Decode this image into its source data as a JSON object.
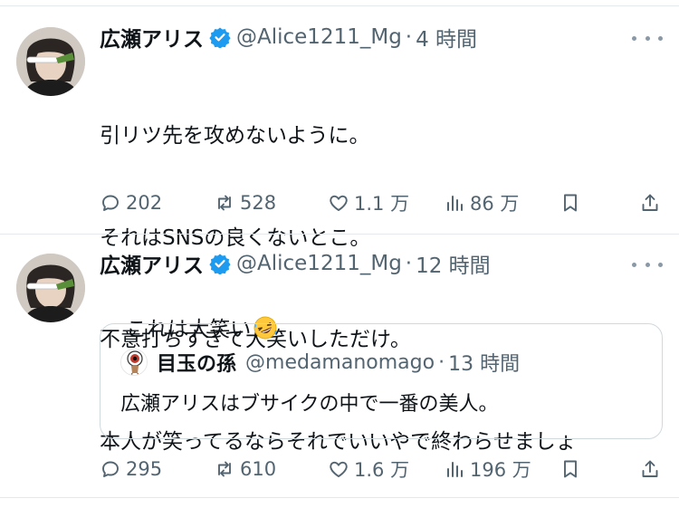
{
  "tweets": [
    {
      "display_name": "広瀬アリス",
      "handle": "@Alice1211_Mg",
      "separator": "·",
      "time": "4 時間",
      "lines": [
        "引リツ先を攻めないように。",
        "それはSNSの良くないとこ。",
        "不意打ちすぎて大笑いしただけ。",
        "本人が笑ってるならそれでいいやで終わらせましょ"
      ],
      "stats": {
        "replies": "202",
        "reposts": "528",
        "likes": "1.1 万",
        "views": "86 万"
      }
    },
    {
      "display_name": "広瀬アリス",
      "handle": "@Alice1211_Mg",
      "separator": "·",
      "time": "12 時間",
      "text": "これは大笑い",
      "emoji": "rolling-on-floor-laughing",
      "quote": {
        "display_name": "目玉の孫",
        "handle": "@medamanomago",
        "separator": "·",
        "time": "13 時間",
        "text": "広瀬アリスはブサイクの中で一番の美人。"
      },
      "stats": {
        "replies": "295",
        "reposts": "610",
        "likes": "1.6 万",
        "views": "196 万"
      }
    }
  ],
  "colors": {
    "text": "#0f1419",
    "secondary": "#536471",
    "verified": "#1d9bf0",
    "divider": "#e6e9ec",
    "border": "#cfd9de"
  }
}
